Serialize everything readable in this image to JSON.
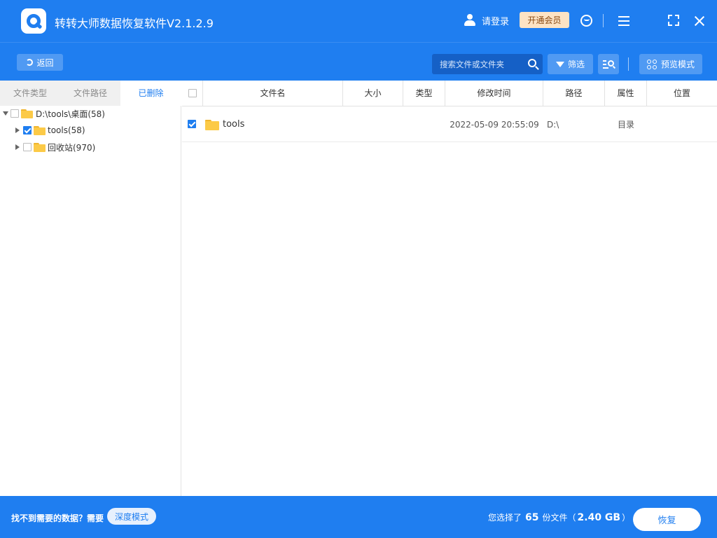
{
  "app": {
    "title": "转转大师数据恢复软件V2.1.2.9"
  },
  "titlebar": {
    "login_label": "请登录",
    "vip_label": "开通会员"
  },
  "toolbar": {
    "back_label": "返回",
    "search_placeholder": "搜索文件或文件夹",
    "filter_label": "筛选",
    "preview_label": "预览模式"
  },
  "left": {
    "tabs": [
      {
        "label": "文件类型",
        "active": false
      },
      {
        "label": "文件路径",
        "active": false
      },
      {
        "label": "已删除",
        "active": true
      }
    ],
    "tree": [
      {
        "label": "D:\\tools\\桌面(58)",
        "checked": false,
        "expanded": true,
        "level": 0
      },
      {
        "label": "tools(58)",
        "checked": true,
        "expanded": false,
        "level": 1
      },
      {
        "label": "回收站(970)",
        "checked": false,
        "expanded": false,
        "level": 1
      }
    ]
  },
  "table": {
    "columns": [
      "文件名",
      "大小",
      "类型",
      "修改时间",
      "路径",
      "属性",
      "位置"
    ],
    "rows": [
      {
        "checked": true,
        "name": "tools",
        "size": "",
        "type": "",
        "modified": "2022-05-09 20:55:09",
        "path": "D:\\",
        "attr": "目录",
        "location": ""
      }
    ]
  },
  "status": {
    "hint": "找不到需要的数据？需要",
    "deep_mode_label": "深度模式",
    "selected_prefix": "您选择了",
    "selected_count": "65",
    "selected_unit": "份文件（",
    "selected_size": "2.40 GB",
    "selected_suffix": "）",
    "recover_label": "恢复"
  },
  "colors": {
    "primary": "#1f7ef0",
    "vip_bg": "#fde3c4",
    "folder": "#fcca47"
  },
  "icons": [
    "app-logo",
    "user-icon",
    "headset-icon",
    "menu-icon",
    "maximize-icon",
    "close-icon",
    "back-arrow-icon",
    "search-icon",
    "filter-icon",
    "list-search-icon",
    "grid-icon",
    "folder-icon"
  ]
}
